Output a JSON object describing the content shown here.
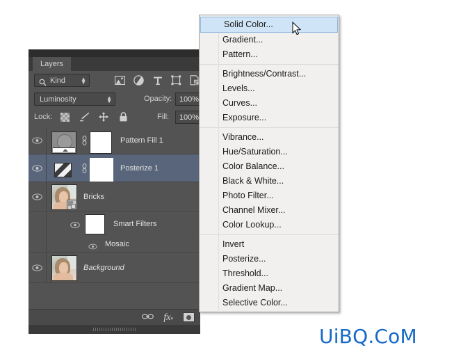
{
  "panel": {
    "tab_label": "Layers",
    "filter": {
      "kind_label": "Kind",
      "search_icon": "search-icon",
      "icons": [
        "pixel-layer-filter-icon",
        "adjustment-layer-filter-icon",
        "type-layer-filter-icon",
        "shape-layer-filter-icon",
        "smart-object-filter-icon"
      ],
      "toggle_icon": "filter-toggle-switch"
    },
    "blend": {
      "mode": "Luminosity",
      "opacity_label": "Opacity:",
      "opacity_value": "100%",
      "fill_label": "Fill:",
      "fill_value": "100%"
    },
    "lock": {
      "label": "Lock:",
      "icons": [
        "lock-transparent-pixels-icon",
        "lock-image-pixels-icon",
        "lock-position-icon",
        "lock-all-icon"
      ]
    },
    "layers": [
      {
        "name": "Pattern Fill 1",
        "visible": true,
        "selected": false,
        "italic": false
      },
      {
        "name": "Posterize 1",
        "visible": true,
        "selected": true,
        "italic": false
      },
      {
        "name": "Bricks",
        "visible": true,
        "selected": false,
        "italic": false
      },
      {
        "name": "Smart Filters",
        "visible": true,
        "selected": false,
        "italic": false
      },
      {
        "name": "Mosaic",
        "visible": true,
        "selected": false,
        "italic": false
      },
      {
        "name": "Background",
        "visible": true,
        "selected": false,
        "italic": true
      }
    ],
    "footer_icons": [
      "link-layers-icon",
      "add-layer-style-fx-icon",
      "add-adjustment-layer-icon"
    ]
  },
  "menu": {
    "highlighted": "Solid Color...",
    "groups": [
      [
        "Solid Color...",
        "Gradient...",
        "Pattern..."
      ],
      [
        "Brightness/Contrast...",
        "Levels...",
        "Curves...",
        "Exposure..."
      ],
      [
        "Vibrance...",
        "Hue/Saturation...",
        "Color Balance...",
        "Black & White...",
        "Photo Filter...",
        "Channel Mixer...",
        "Color Lookup..."
      ],
      [
        "Invert",
        "Posterize...",
        "Threshold...",
        "Gradient Map...",
        "Selective Color..."
      ]
    ]
  },
  "cursor": {
    "icon": "mouse-arrow-cursor"
  },
  "watermark": {
    "text": "UiBQ.CoM",
    "color": "#1569c7"
  }
}
